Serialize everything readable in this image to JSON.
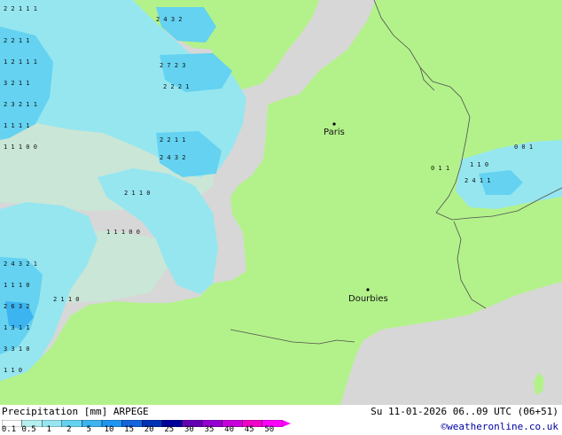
{
  "map": {
    "colors": {
      "sea": "#d7d7d7",
      "land": "#b3f28a",
      "border": "#505050"
    },
    "cities": [
      {
        "name": "Paris"
      },
      {
        "name": "Dourbies"
      }
    ]
  },
  "legend": {
    "title": "Precipitation [mm]",
    "model": "ARPEGE",
    "valid_time": "Su 11-01-2026 06..09 UTC (06+51)",
    "credit": "©weatheronline.co.uk",
    "ticks": [
      "0.1",
      "0.5",
      "1",
      "2",
      "5",
      "10",
      "15",
      "20",
      "25",
      "30",
      "35",
      "40",
      "45",
      "50"
    ],
    "colors": [
      "#ffffff",
      "#b4f0f0",
      "#96e6f0",
      "#64d2f0",
      "#3cb4f0",
      "#1e96f0",
      "#1464dc",
      "#0032b4",
      "#00009c",
      "#6400b4",
      "#9600d2",
      "#c800dc",
      "#f000c8",
      "#ff00ff"
    ]
  }
}
